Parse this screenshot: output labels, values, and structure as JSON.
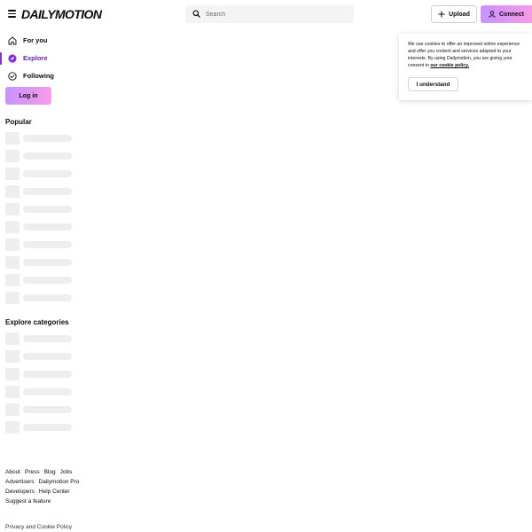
{
  "header": {
    "logo": "DAILYMOTION",
    "search_placeholder": "Search",
    "upload_label": "Upload",
    "connect_label": "Connect"
  },
  "sidebar": {
    "items": [
      {
        "label": "For you",
        "icon": "home-icon",
        "active": false
      },
      {
        "label": "Explore",
        "icon": "compass-icon",
        "active": true
      },
      {
        "label": "Following",
        "icon": "check-circle-icon",
        "active": false
      }
    ],
    "login_label": "Log in",
    "popular_title": "Popular",
    "categories_title": "Explore categories"
  },
  "footer": {
    "links": [
      [
        "About",
        "Press",
        "Blog",
        "Jobs"
      ],
      [
        "Advertisers",
        "Dailymotion Pro"
      ],
      [
        "Developers",
        "Help Center"
      ],
      [
        "Suggest a feature"
      ]
    ],
    "privacy": "Privacy and Cookie Policy"
  },
  "cookie_banner": {
    "text": "We use cookies to offer an improved online experience and offer you content and services adapted to your interests. By using Dailymotion, you are giving your consent to",
    "link": "our cookie policy.",
    "button": "I understand"
  },
  "colors": {
    "accent": "#8b2fd6",
    "gradient_start": "#c792ff",
    "gradient_end": "#f79be6",
    "skeleton": "#eeeeee"
  }
}
